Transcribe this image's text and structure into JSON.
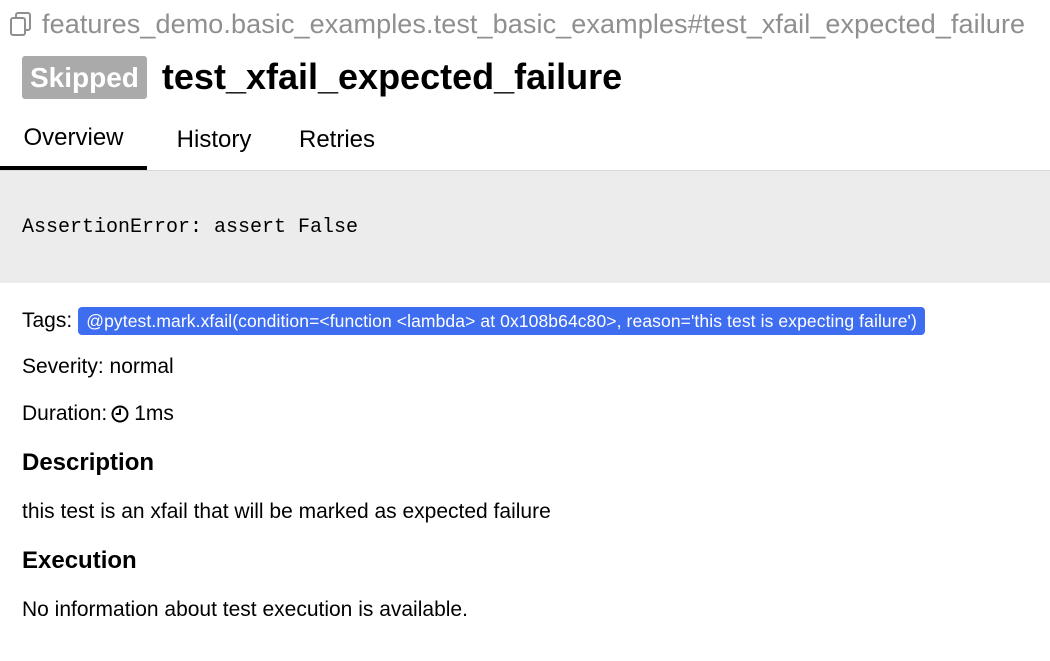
{
  "header": {
    "fullname": "features_demo.basic_examples.test_basic_examples#test_xfail_expected_failure",
    "status": "Skipped",
    "title": "test_xfail_expected_failure"
  },
  "tabs": [
    {
      "label": "Overview",
      "active": true
    },
    {
      "label": "History",
      "active": false
    },
    {
      "label": "Retries",
      "active": false
    }
  ],
  "error": {
    "message": "AssertionError: assert False"
  },
  "details": {
    "tags_label": "Tags:",
    "tags": [
      "@pytest.mark.xfail(condition=<function <lambda> at 0x108b64c80>, reason='this test is expecting failure')"
    ],
    "severity_text": "Severity: normal",
    "duration_label": "Duration:",
    "duration_value": "1ms"
  },
  "description": {
    "heading": "Description",
    "text": "this test is an xfail that will be marked as expected failure"
  },
  "execution": {
    "heading": "Execution",
    "text": "No information about test execution is available."
  },
  "icons": {
    "copy": "copy-icon",
    "clock": "clock-icon"
  },
  "colors": {
    "status_skipped": "#aaaaaa",
    "tag_background": "#3e6df0",
    "error_background": "#ececec",
    "fullname_text": "#8f8f8f"
  }
}
